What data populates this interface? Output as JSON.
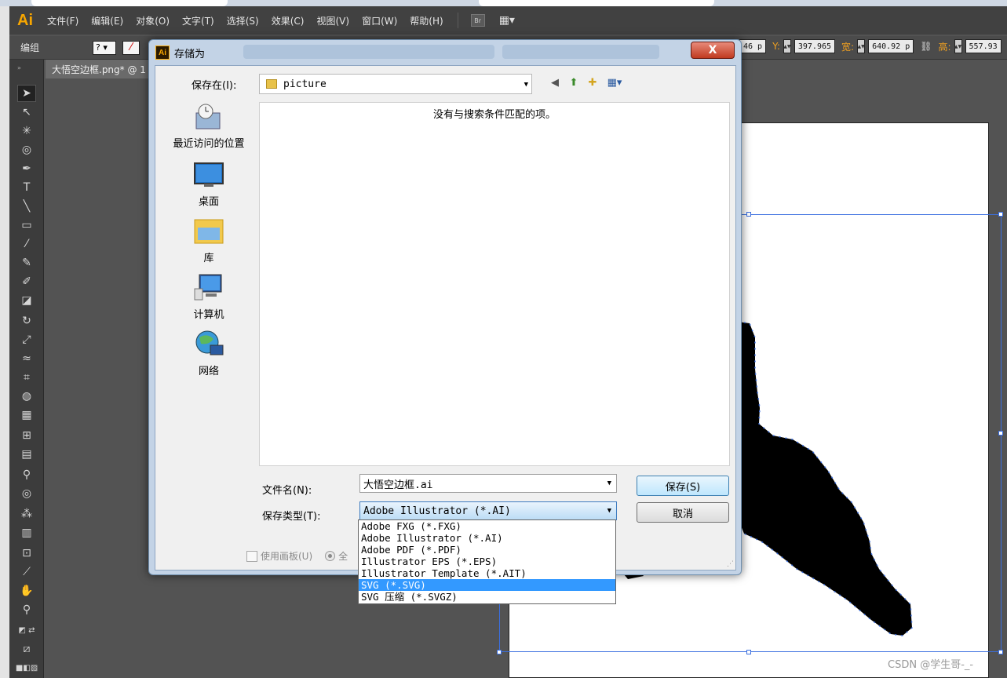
{
  "app": {
    "logo": "Ai"
  },
  "menu": [
    {
      "label": "文件(F)"
    },
    {
      "label": "编辑(E)"
    },
    {
      "label": "对象(O)"
    },
    {
      "label": "文字(T)"
    },
    {
      "label": "选择(S)"
    },
    {
      "label": "效果(C)"
    },
    {
      "label": "视图(V)"
    },
    {
      "label": "窗口(W)"
    },
    {
      "label": "帮助(H)"
    }
  ],
  "menu_extra": {
    "bridge": "Br"
  },
  "control_bar": {
    "label": "编组",
    "stroke_box": "?",
    "x_partial": "46 p",
    "y_key": "Y:",
    "y_value": "397.965",
    "w_key": "宽:",
    "w_value": "640.92 p",
    "h_key": "高:",
    "h_value": "557.93"
  },
  "document": {
    "tab": "大悟空边框.png* @ 1"
  },
  "dialog": {
    "title": "存储为",
    "close": "X",
    "save_in_label": "保存在(I):",
    "save_in_value": "picture",
    "empty_message": "没有与搜索条件匹配的项。",
    "places": [
      {
        "label": "最近访问的位置",
        "icon": "recent-places-icon"
      },
      {
        "label": "桌面",
        "icon": "desktop-icon"
      },
      {
        "label": "库",
        "icon": "libraries-icon"
      },
      {
        "label": "计算机",
        "icon": "computer-icon"
      },
      {
        "label": "网络",
        "icon": "network-icon"
      }
    ],
    "filename_label": "文件名(N):",
    "filename_value": "大悟空边框.ai",
    "filetype_label": "保存类型(T):",
    "filetype_value": "Adobe Illustrator (*.AI)",
    "save_button": "保存(S)",
    "cancel_button": "取消",
    "use_artboards": "使用画板(U)",
    "all_partial": "全",
    "filetype_options": [
      {
        "label": "Adobe FXG (*.FXG)",
        "selected": false
      },
      {
        "label": "Adobe Illustrator (*.AI)",
        "selected": false
      },
      {
        "label": "Adobe PDF (*.PDF)",
        "selected": false
      },
      {
        "label": "Illustrator EPS (*.EPS)",
        "selected": false
      },
      {
        "label": "Illustrator Template (*.AIT)",
        "selected": false
      },
      {
        "label": "SVG (*.SVG)",
        "selected": true
      },
      {
        "label": "SVG 压缩 (*.SVGZ)",
        "selected": false
      }
    ]
  },
  "watermark": "CSDN @学生哥-_-",
  "colors": {
    "selection": "#3399ff",
    "bbox": "#3b6fe0",
    "ai_orange": "#f7a600"
  }
}
